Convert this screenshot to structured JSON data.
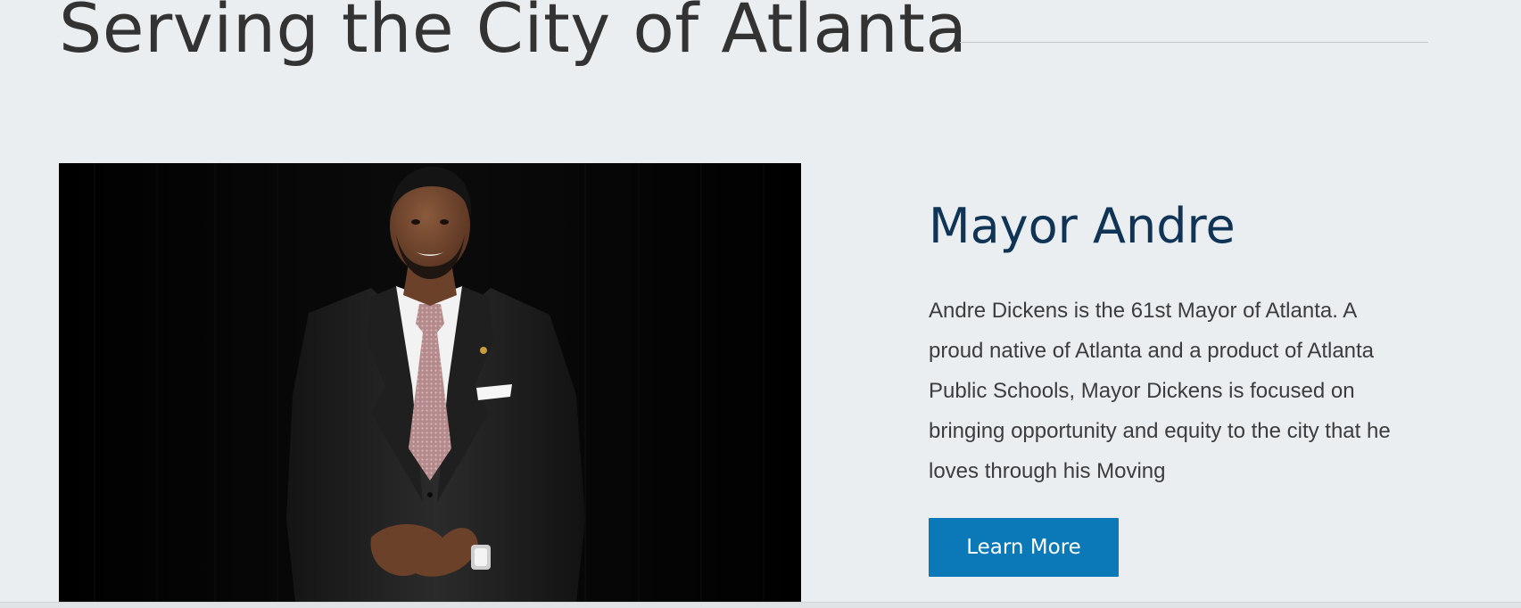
{
  "section": {
    "title": "Serving the City of Atlanta"
  },
  "mayor": {
    "photo_alt": "Mayor Andre Dickens portrait",
    "heading": "Mayor Andre",
    "bio": "Andre Dickens is the 61st Mayor of Atlanta. A proud native of Atlanta and a product of Atlanta Public Schools, Mayor Dickens is focused on bringing opportunity and equity to the city that he loves through his Moving",
    "button_label": "Learn More"
  },
  "colors": {
    "background": "#eaeef1",
    "title_text": "#333333",
    "heading_text": "#0f3455",
    "body_text": "#3c3c3c",
    "button_bg": "#0b79b7",
    "button_text": "#ffffff"
  }
}
